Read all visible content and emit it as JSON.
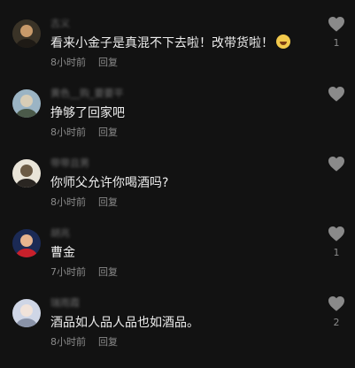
{
  "comments": [
    {
      "username": "古义",
      "content": "看来小金子是真混不下去啦！改带货啦！",
      "time": "8小时前",
      "reply_label": "回复",
      "like_count": "1",
      "avatar_icon": "user-avatar-icon",
      "has_emoji": true,
      "avatar_colors": [
        "#3a3327",
        "#c89a6a",
        "#1e1a15"
      ]
    },
    {
      "username": "黄色__购_要要平",
      "content": "挣够了回家吧",
      "time": "8小时前",
      "reply_label": "回复",
      "like_count": "",
      "avatar_icon": "user-avatar-icon",
      "has_emoji": false,
      "avatar_colors": [
        "#9bb4c4",
        "#d8cdb6",
        "#4b5a4a"
      ]
    },
    {
      "username": "带带且男",
      "content": "你师父允许你喝酒吗?",
      "time": "8小时前",
      "reply_label": "回复",
      "like_count": "",
      "avatar_icon": "user-avatar-icon",
      "has_emoji": false,
      "avatar_colors": [
        "#e9e4d8",
        "#6b5a44",
        "#2a2622"
      ]
    },
    {
      "username": "胡兆",
      "content": "曹金",
      "time": "7小时前",
      "reply_label": "回复",
      "like_count": "1",
      "avatar_icon": "user-avatar-icon",
      "has_emoji": false,
      "avatar_colors": [
        "#1b2a55",
        "#e7b48f",
        "#c8202b"
      ]
    },
    {
      "username": "瑞雨霞",
      "content": "酒品如人品人品也如酒品。",
      "time": "8小时前",
      "reply_label": "回复",
      "like_count": "2",
      "avatar_icon": "user-avatar-icon",
      "has_emoji": false,
      "avatar_colors": [
        "#cfd6e6",
        "#f1e3da",
        "#8a93a8"
      ]
    }
  ],
  "like_icon": "heart-icon",
  "colors": {
    "background": "#121212",
    "text": "#ededed",
    "meta": "#8a8a8a",
    "heart": "#8a8a8a"
  }
}
